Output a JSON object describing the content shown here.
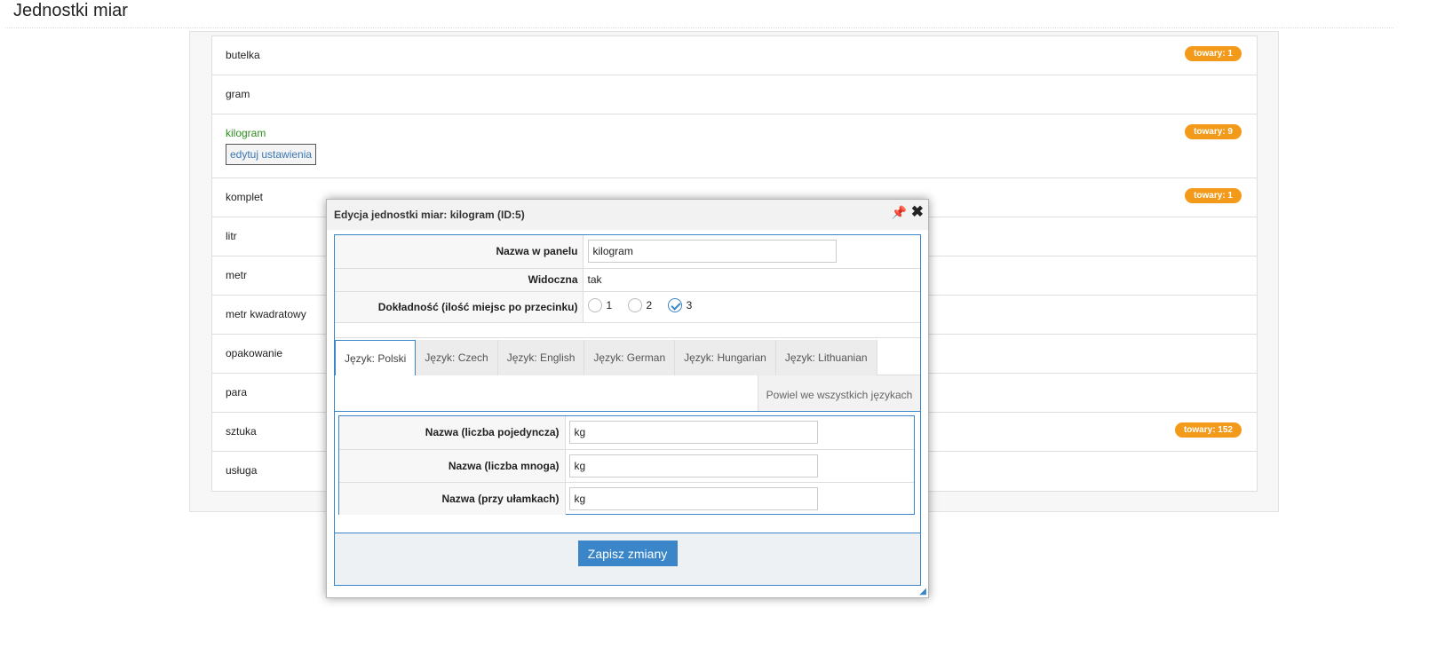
{
  "page": {
    "title": "Jednostki miar"
  },
  "units": [
    {
      "name": "butelka",
      "badge": "towary: 1"
    },
    {
      "name": "gram",
      "badge": ""
    },
    {
      "name": "kilogram",
      "badge": "towary: 9",
      "edit_label": "edytuj ustawienia"
    },
    {
      "name": "komplet",
      "badge": "towary: 1"
    },
    {
      "name": "litr",
      "badge": ""
    },
    {
      "name": "metr",
      "badge": ""
    },
    {
      "name": "metr kwadratowy",
      "badge": ""
    },
    {
      "name": "opakowanie",
      "badge": ""
    },
    {
      "name": "para",
      "badge": ""
    },
    {
      "name": "sztuka",
      "badge": "towary: 152"
    },
    {
      "name": "usługa",
      "badge": ""
    }
  ],
  "colors": {
    "accent": "#3a86c8",
    "badge": "#f39a1a",
    "active_name": "#2e8b1f"
  },
  "dialog": {
    "title": "Edycja jednostki miar: kilogram (ID:5)",
    "fields": {
      "panel_name_label": "Nazwa w panelu",
      "panel_name_value": "kilogram",
      "visible_label": "Widoczna",
      "visible_value": "tak",
      "precision_label": "Dokładność (ilość miejsc po przecinku)",
      "precision_options": [
        "1",
        "2",
        "3"
      ],
      "precision_selected": "3"
    },
    "tabs": [
      {
        "label": "Język: Polski",
        "active": true
      },
      {
        "label": "Język: Czech"
      },
      {
        "label": "Język: English"
      },
      {
        "label": "Język: German"
      },
      {
        "label": "Język: Hungarian"
      },
      {
        "label": "Język: Lithuanian"
      }
    ],
    "copy_all_label": "Powiel we wszystkich językach",
    "lang_fields": [
      {
        "label": "Nazwa (liczba pojedyncza)",
        "value": "kg"
      },
      {
        "label": "Nazwa (liczba mnoga)",
        "value": "kg"
      },
      {
        "label": "Nazwa (przy ułamkach)",
        "value": "kg"
      }
    ],
    "save_label": "Zapisz zmiany",
    "icons": {
      "pin": "pin-icon",
      "close": "close-icon",
      "resize": "resize-grip-icon"
    }
  }
}
